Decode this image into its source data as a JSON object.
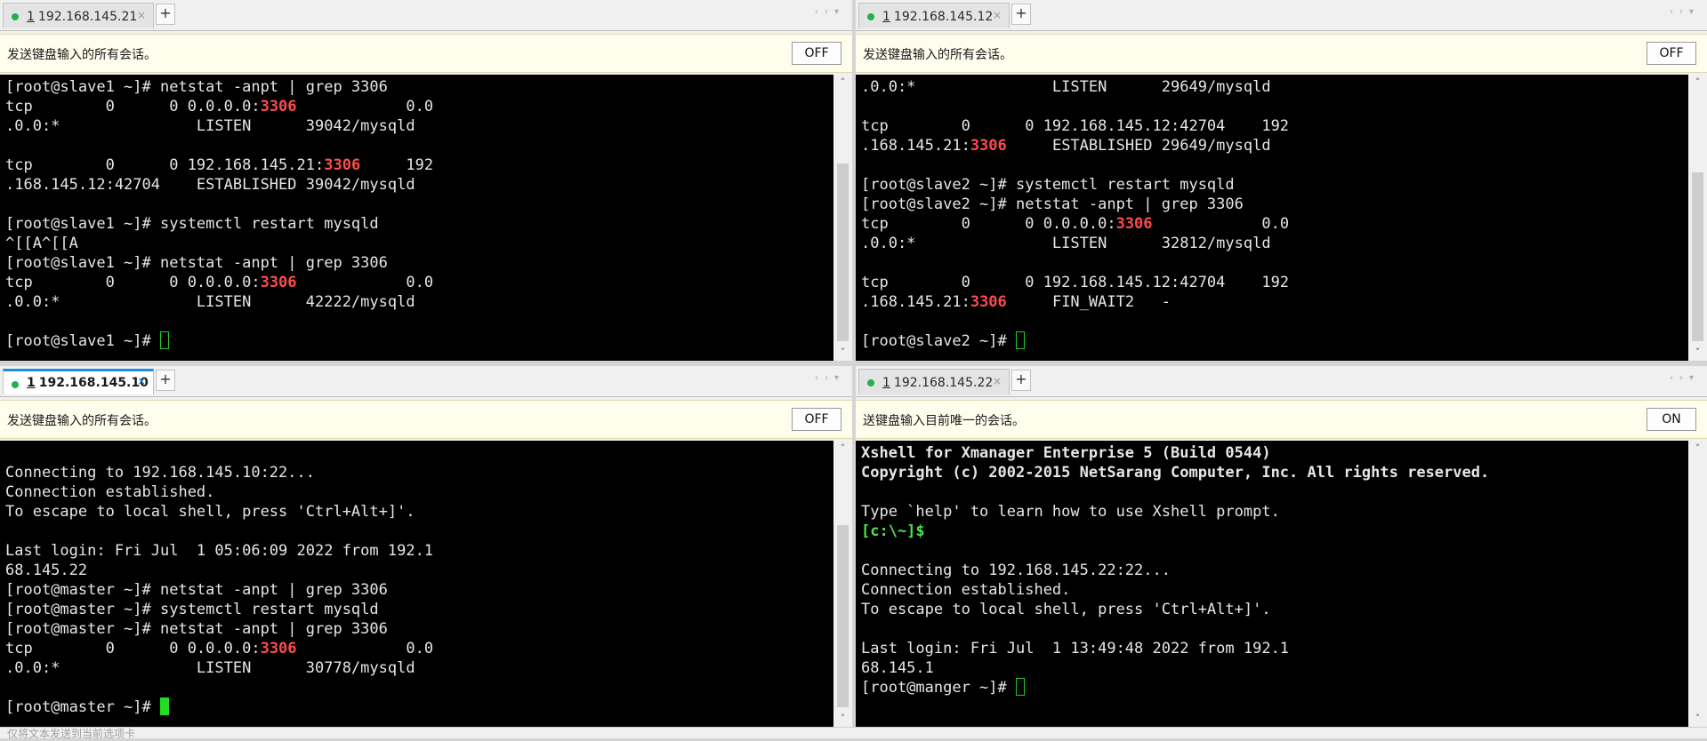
{
  "panes": [
    {
      "tab": {
        "num": "1",
        "host": "192.168.145.21",
        "close": "×"
      },
      "broadcast": {
        "label": "发送键盘输入的所有会话。",
        "button": "OFF"
      },
      "lines": [
        "[root@slave1 ~]# netstat -anpt | grep 3306",
        "tcp        0      0 0.0.0.0:{3306}            0.0",
        ".0.0:*               LISTEN      39042/mysqld",
        "",
        "tcp        0      0 192.168.145.21:{3306}     192",
        ".168.145.12:42704    ESTABLISHED 39042/mysqld",
        "",
        "[root@slave1 ~]# systemctl restart mysqld",
        "^[[A^[[A",
        "[root@slave1 ~]# netstat -anpt | grep 3306",
        "tcp        0      0 0.0.0.0:{3306}            0.0",
        ".0.0:*               LISTEN      42222/mysqld",
        "",
        "[root@slave1 ~]# "
      ]
    },
    {
      "tab": {
        "num": "1",
        "host": "192.168.145.12",
        "close": "×"
      },
      "broadcast": {
        "label": "发送键盘输入的所有会话。",
        "button": "OFF"
      },
      "lines": [
        ".0.0:*               LISTEN      29649/mysqld",
        "",
        "tcp        0      0 192.168.145.12:42704    192",
        ".168.145.21:{3306}     ESTABLISHED 29649/mysqld",
        "",
        "[root@slave2 ~]# systemctl restart mysqld",
        "[root@slave2 ~]# netstat -anpt | grep 3306",
        "tcp        0      0 0.0.0.0:{3306}            0.0",
        ".0.0:*               LISTEN      32812/mysqld",
        "",
        "tcp        0      0 192.168.145.12:42704    192",
        ".168.145.21:{3306}     FIN_WAIT2   -",
        "",
        "[root@slave2 ~]# "
      ]
    },
    {
      "tab": {
        "num": "1",
        "host": "192.168.145.10",
        "close": "×"
      },
      "broadcast": {
        "label": "发送键盘输入的所有会话。",
        "button": "OFF"
      },
      "lines": [
        "",
        "Connecting to 192.168.145.10:22...",
        "Connection established.",
        "To escape to local shell, press 'Ctrl+Alt+]'.",
        "",
        "Last login: Fri Jul  1 05:06:09 2022 from 192.1",
        "68.145.22",
        "[root@master ~]# netstat -anpt | grep 3306",
        "[root@master ~]# systemctl restart mysqld",
        "[root@master ~]# netstat -anpt | grep 3306",
        "tcp        0      0 0.0.0.0:{3306}            0.0",
        ".0.0:*               LISTEN      30778/mysqld",
        "",
        "[root@master ~]# "
      ]
    },
    {
      "tab": {
        "num": "1",
        "host": "192.168.145.22",
        "close": "×"
      },
      "broadcast": {
        "label": "送键盘输入目前唯一的会话。",
        "button": "ON"
      },
      "lines": [
        "Xshell for Xmanager Enterprise 5 (Build 0544)",
        "Copyright (c) 2002-2015 NetSarang Computer, Inc. All rights reserved.",
        "",
        "Type `help' to learn how to use Xshell prompt.",
        "[c:\\~]$",
        "",
        "Connecting to 192.168.145.22:22...",
        "Connection established.",
        "To escape to local shell, press 'Ctrl+Alt+]'.",
        "",
        "Last login: Fri Jul  1 13:49:48 2022 from 192.1",
        "68.145.1",
        "[root@manger ~]# "
      ]
    }
  ],
  "icons": {
    "scroll_up": "˄",
    "scroll_down": "˅",
    "tab_add": "+",
    "tab_nav": "‹›▾"
  },
  "statusbar": {
    "text": "仅将文本发送到当前选项卡"
  },
  "colors": {
    "highlight_port": "#ff4b4b",
    "prompt_green": "#4fe14f",
    "cursor": "#22dd22",
    "active_tab_accent": "#1b8ee6"
  }
}
